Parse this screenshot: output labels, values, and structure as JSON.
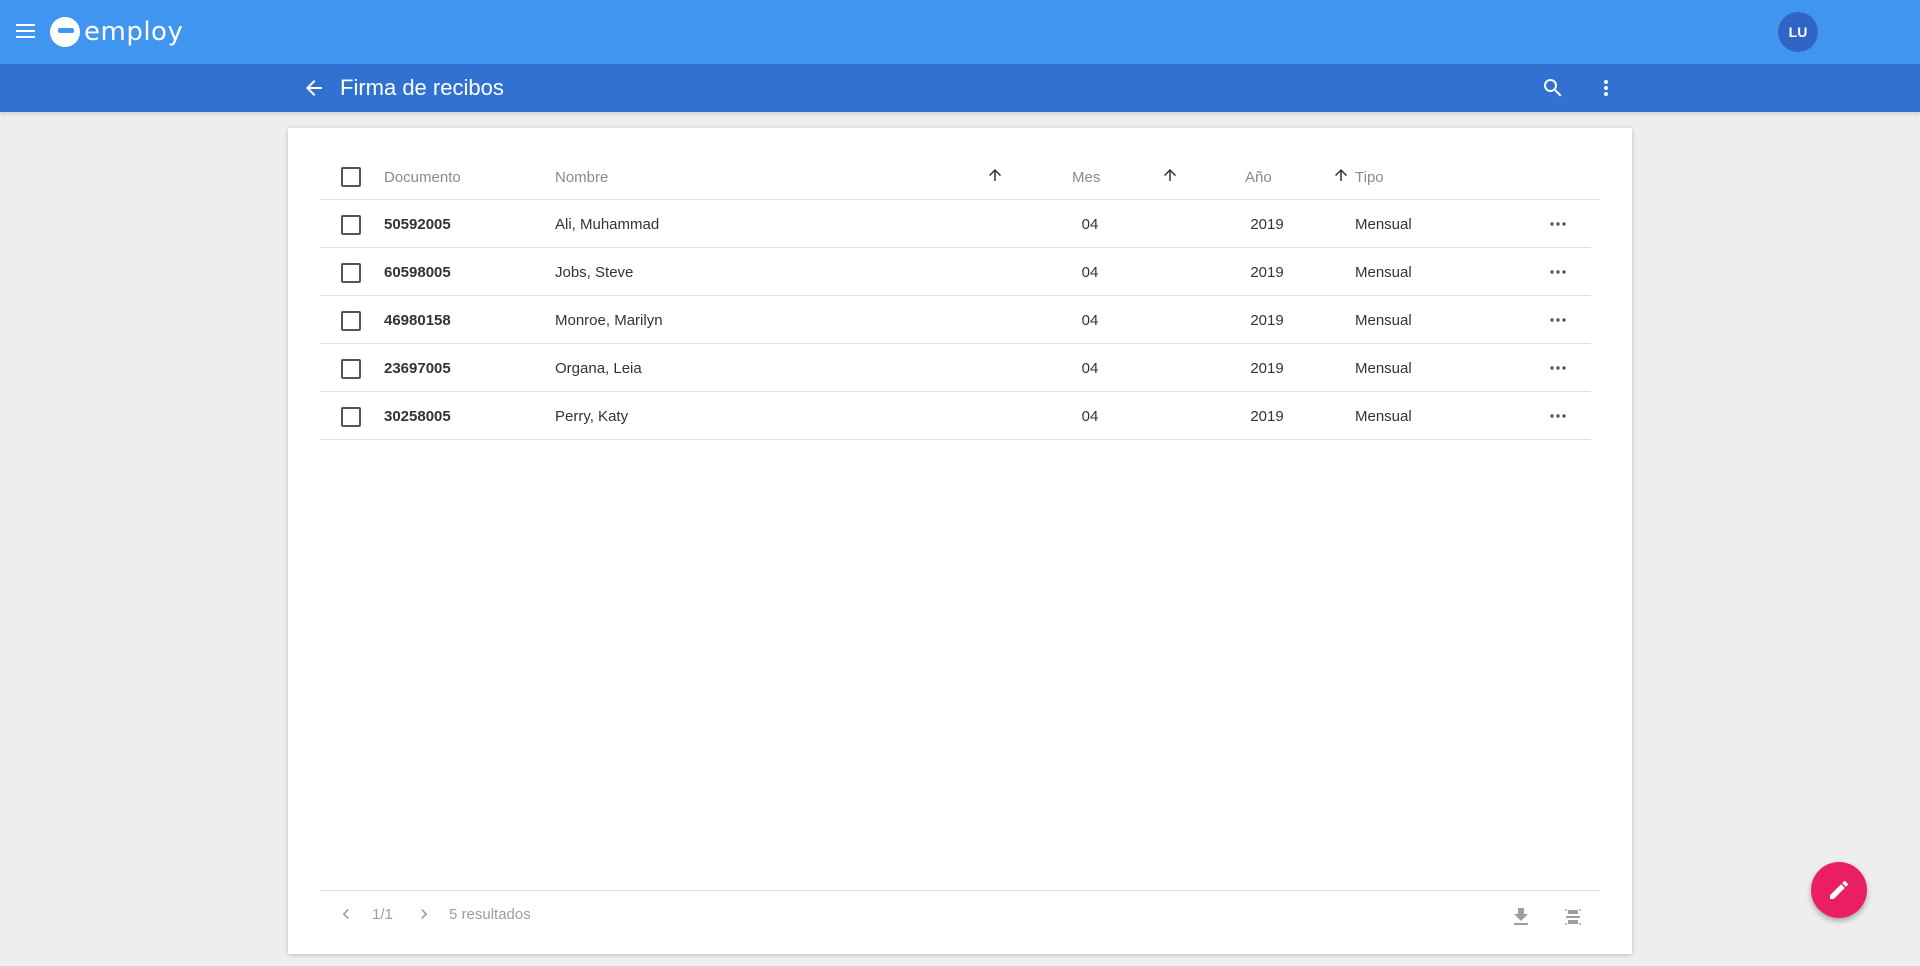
{
  "app": {
    "logo_text": "employ",
    "user_initials": "LU"
  },
  "header": {
    "title": "Firma de recibos"
  },
  "table": {
    "columns": {
      "documento": "Documento",
      "nombre": "Nombre",
      "mes": "Mes",
      "ano": "Año",
      "tipo": "Tipo"
    },
    "rows": [
      {
        "documento": "50592005",
        "nombre": "Ali, Muhammad",
        "mes": "04",
        "ano": "2019",
        "tipo": "Mensual"
      },
      {
        "documento": "60598005",
        "nombre": "Jobs, Steve",
        "mes": "04",
        "ano": "2019",
        "tipo": "Mensual"
      },
      {
        "documento": "46980158",
        "nombre": "Monroe, Marilyn",
        "mes": "04",
        "ano": "2019",
        "tipo": "Mensual"
      },
      {
        "documento": "23697005",
        "nombre": "Organa, Leia",
        "mes": "04",
        "ano": "2019",
        "tipo": "Mensual"
      },
      {
        "documento": "30258005",
        "nombre": "Perry, Katy",
        "mes": "04",
        "ano": "2019",
        "tipo": "Mensual"
      }
    ]
  },
  "pagination": {
    "page_indicator": "1/1",
    "results": "5 resultados"
  },
  "colors": {
    "primary": "#4095f0",
    "primary_dark": "#3171d2",
    "avatar": "#3065c5",
    "fab": "#e91e63"
  },
  "icons": [
    "menu-icon",
    "arrow-back-icon",
    "search-icon",
    "more-vert-icon",
    "arrow-upward-icon",
    "more-horiz-icon",
    "chevron-left-icon",
    "chevron-right-icon",
    "download-icon",
    "split-icon",
    "edit-icon"
  ]
}
